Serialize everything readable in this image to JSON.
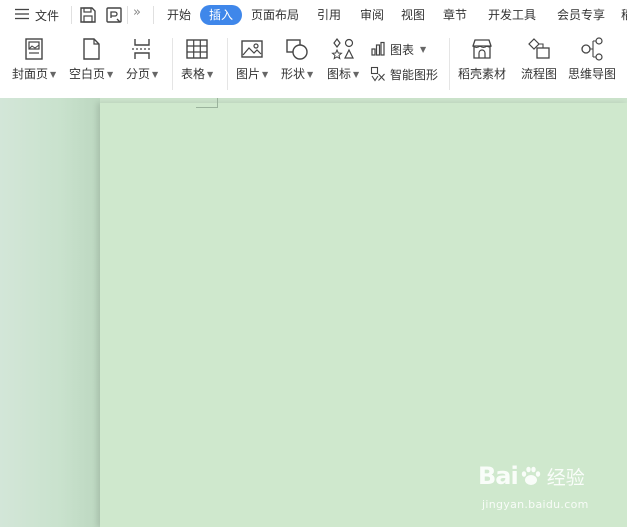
{
  "toolbar": {
    "file_label": "文件",
    "more_glyph": "»"
  },
  "tabs": [
    {
      "label": "开始",
      "active": false
    },
    {
      "label": "插入",
      "active": true
    },
    {
      "label": "页面布局",
      "active": false
    },
    {
      "label": "引用",
      "active": false
    },
    {
      "label": "审阅",
      "active": false
    },
    {
      "label": "视图",
      "active": false
    },
    {
      "label": "章节",
      "active": false
    },
    {
      "label": "开发工具",
      "active": false
    },
    {
      "label": "会员专享",
      "active": false
    },
    {
      "label": "稻",
      "active": false
    }
  ],
  "ribbon": {
    "cover_page": "封面页",
    "blank_page": "空白页",
    "page_break": "分页",
    "table": "表格",
    "picture": "图片",
    "shape": "形状",
    "icons": "图标",
    "chart": "图表",
    "smart_art": "智能图形",
    "docer_material": "稻壳素材",
    "flowchart": "流程图",
    "mind_map": "思维导图"
  },
  "icons": {
    "menu": "hamburger-menu-icon",
    "save": "save-icon",
    "export": "export-icon",
    "more": "double-chevron-icon",
    "cover_page": "cover-page-icon",
    "blank_page": "blank-page-icon",
    "page_break": "page-break-icon",
    "table": "table-icon",
    "picture": "picture-icon",
    "shape": "shape-icon",
    "icons": "icon-library-icon",
    "chart": "bar-chart-icon",
    "smart_art": "smart-art-icon",
    "docer_material": "store-icon",
    "flowchart": "flowchart-icon",
    "mind_map": "mind-map-icon"
  },
  "watermark": {
    "brand_left": "Bai",
    "brand_right": "经验",
    "url": "jingyan.baidu.com"
  },
  "colors": {
    "accent": "#3f87ea",
    "page_background": "#cfe8cd",
    "canvas_background": "#c8e2cc"
  }
}
